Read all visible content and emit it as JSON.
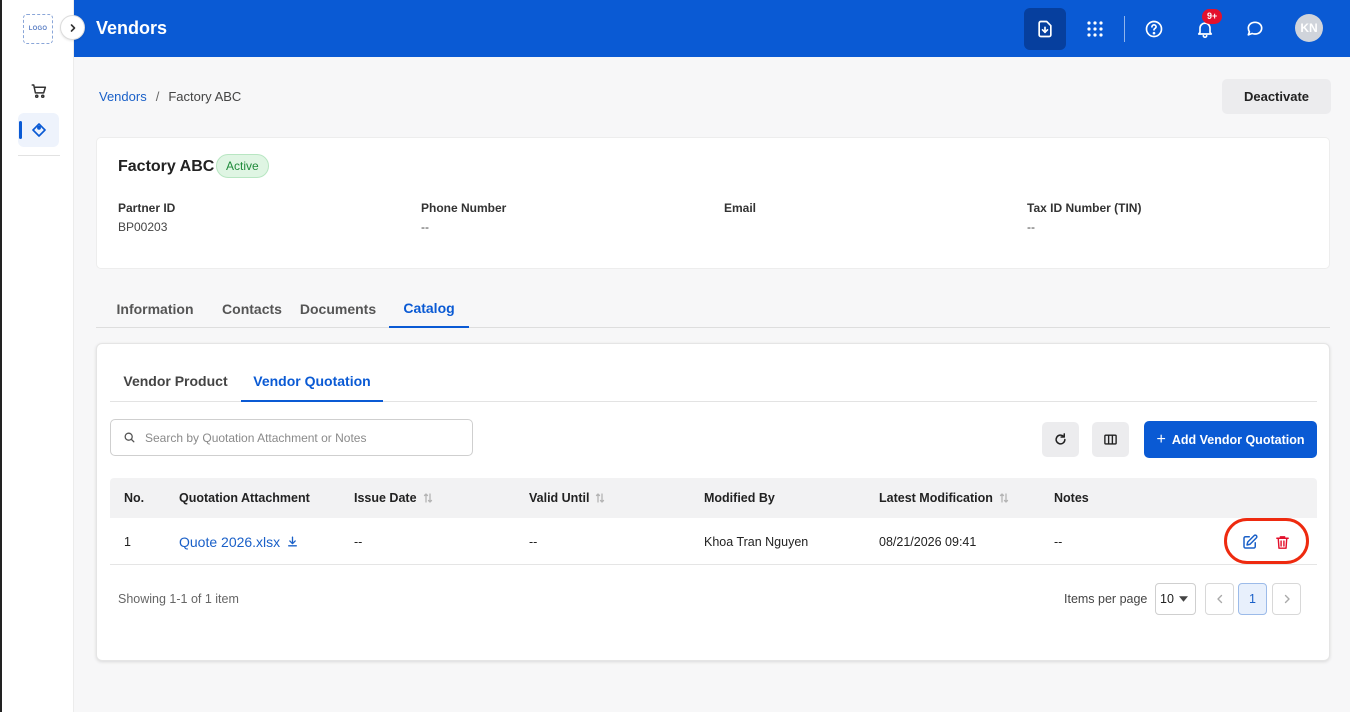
{
  "sidebar": {
    "logo_text": "LOGO"
  },
  "header": {
    "title": "Vendors",
    "notification_badge": "9+",
    "avatar_initials": "KN"
  },
  "breadcrumb": {
    "parent": "Vendors",
    "separator": "/",
    "current": "Factory ABC"
  },
  "actions": {
    "deactivate_label": "Deactivate"
  },
  "vendor": {
    "name": "Factory ABC",
    "status": "Active",
    "fields": [
      {
        "label": "Partner ID",
        "value": "BP00203"
      },
      {
        "label": "Phone Number",
        "value": "--"
      },
      {
        "label": "Email",
        "value": ""
      },
      {
        "label": "Tax ID Number (TIN)",
        "value": "--"
      }
    ]
  },
  "main_tabs": [
    {
      "label": "Information"
    },
    {
      "label": "Contacts"
    },
    {
      "label": "Documents"
    },
    {
      "label": "Catalog"
    }
  ],
  "sub_tabs": [
    {
      "label": "Vendor Product"
    },
    {
      "label": "Vendor Quotation"
    }
  ],
  "search": {
    "placeholder": "Search by Quotation Attachment or Notes"
  },
  "toolbar": {
    "add_label": "Add Vendor Quotation",
    "add_icon": "+"
  },
  "table": {
    "columns": [
      "No.",
      "Quotation Attachment",
      "Issue Date",
      "Valid Until",
      "Modified By",
      "Latest Modification",
      "Notes"
    ],
    "rows": [
      {
        "no": "1",
        "attachment": "Quote 2026.xlsx",
        "issue_date": "--",
        "valid_until": "--",
        "modified_by": "Khoa Tran Nguyen",
        "latest_modification": "08/21/2026 09:41",
        "notes": "--"
      }
    ]
  },
  "pagination": {
    "showing": "Showing 1-1 of 1 item",
    "items_per_page_label": "Items per page",
    "items_per_page": "10",
    "current_page": "1"
  },
  "colors": {
    "primary": "#0a5ad4",
    "header_active": "#063f9e",
    "danger": "#e3112c",
    "success_bg": "#dff5e3",
    "highlight_ring": "#ee2a0f"
  }
}
